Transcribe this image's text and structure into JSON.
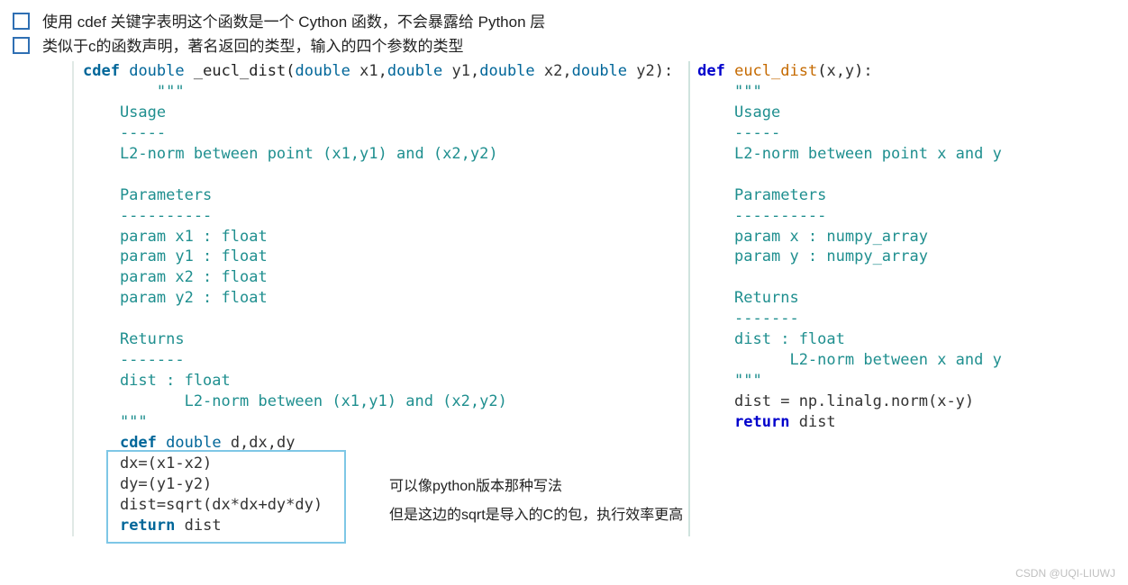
{
  "bullets": {
    "b1": "使用 cdef 关键字表明这个函数是一个 Cython 函数，不会暴露给 Python 层",
    "b2": "类似于c的函数声明，著名返回的类型，输入的四个参数的类型"
  },
  "left_code": {
    "l0": "cdef double _eucl_dist(double x1,double y1,double x2,double y2):",
    "l1": "    \"\"\"",
    "l2": "    Usage",
    "l3": "    -----",
    "l4": "    L2-norm between point (x1,y1) and (x2,y2)",
    "l5": "",
    "l6": "    Parameters",
    "l7": "    ----------",
    "l8": "    param x1 : float",
    "l9": "    param y1 : float",
    "l10": "    param x2 : float",
    "l11": "    param y2 : float",
    "l12": "",
    "l13": "    Returns",
    "l14": "    -------",
    "l15": "    dist : float",
    "l16": "           L2-norm between (x1,y1) and (x2,y2)",
    "l17": "    \"\"\"",
    "l18": "    cdef double d,dx,dy",
    "l19": "    dx=(x1-x2)",
    "l20": "    dy=(y1-y2)",
    "l21": "    dist=sqrt(dx*dx+dy*dy)",
    "l22": "    return dist"
  },
  "right_code": {
    "r0": "def eucl_dist(x,y):",
    "r1": "    \"\"\"",
    "r2": "    Usage",
    "r3": "    -----",
    "r4": "    L2-norm between point x and y",
    "r5": "",
    "r6": "    Parameters",
    "r7": "    ----------",
    "r8": "    param x : numpy_array",
    "r9": "    param y : numpy_array",
    "r10": "",
    "r11": "    Returns",
    "r12": "    -------",
    "r13": "    dist : float",
    "r14": "          L2-norm between x and y",
    "r15": "    \"\"\"",
    "r16": "    dist = np.linalg.norm(x-y)",
    "r17": "    return dist"
  },
  "annotations": {
    "a1": "可以像python版本那种写法",
    "a2": "但是这边的sqrt是导入的C的包，执行效率更高"
  },
  "watermark": "CSDN @UQI-LIUWJ"
}
